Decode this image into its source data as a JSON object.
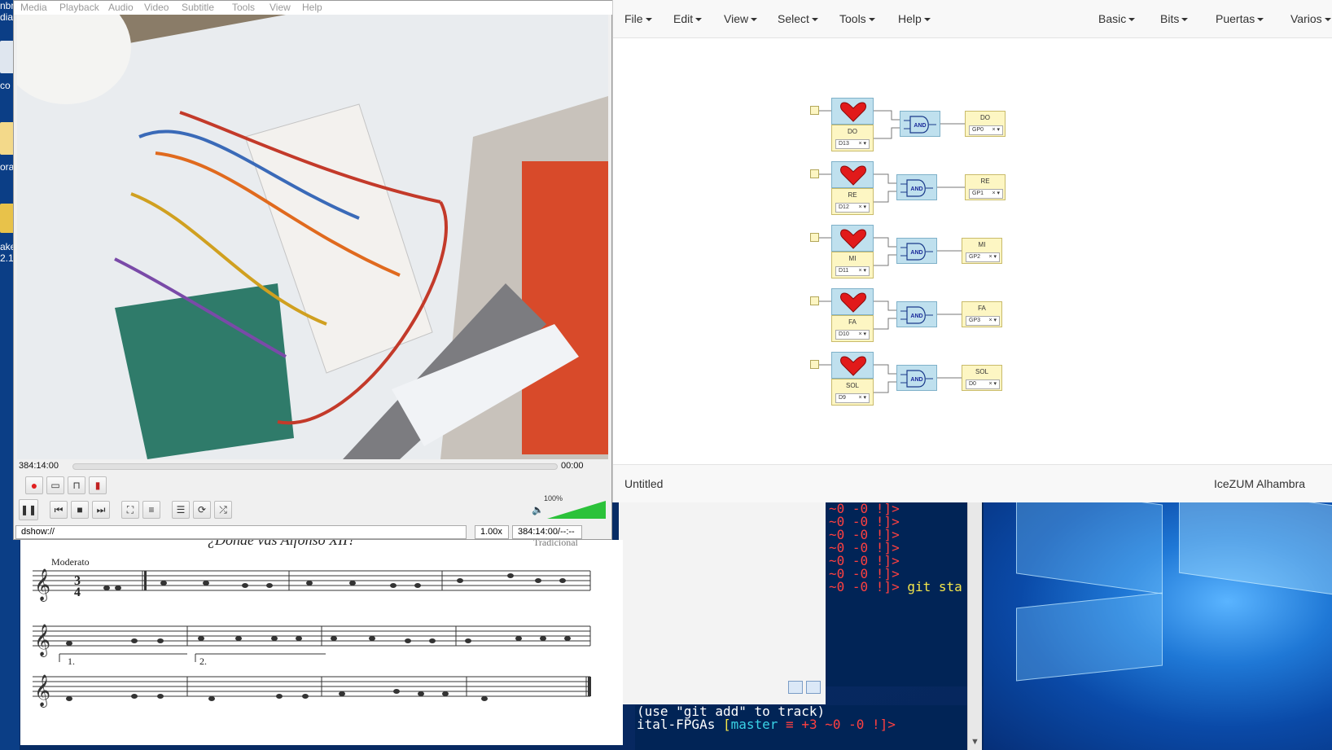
{
  "desktop": {
    "left_icon_texts": [
      "nbr",
      "dia",
      "co",
      "ora",
      "ake",
      "2.1"
    ]
  },
  "vlc": {
    "menu": [
      "Media",
      "Playback",
      "Audio",
      "Video",
      "Subtitle",
      "Tools",
      "View",
      "Help"
    ],
    "elapsed": "384:14:00",
    "remaining": "00:00",
    "volume": "100%",
    "volume_level": 1.0,
    "source": "dshow://",
    "speed": "1.00x",
    "time_status": "384:14:00/--:--"
  },
  "sheet": {
    "title": "¿Donde vas Alfonso XII?",
    "composer": "Tradicional",
    "tempo": "Moderato",
    "time_signature_top": "3",
    "time_signature_bottom": "4",
    "ending1": "1.",
    "ending2": "2."
  },
  "icestudio": {
    "menus": [
      "File",
      "Edit",
      "View",
      "Select",
      "Tools",
      "Help"
    ],
    "right_menus": [
      "Basic",
      "Bits",
      "Puertas",
      "Varios"
    ],
    "footer_left": "Untitled",
    "footer_right": "IceZUM Alhambra",
    "rows": [
      {
        "note": "DO",
        "in_pin": "D13",
        "out_label": "DO",
        "out_pin": "GP0"
      },
      {
        "note": "RE",
        "in_pin": "D12",
        "out_label": "RE",
        "out_pin": "GP1"
      },
      {
        "note": "MI",
        "in_pin": "D11",
        "out_label": "MI",
        "out_pin": "GP2"
      },
      {
        "note": "FA",
        "in_pin": "D10",
        "out_label": "FA",
        "out_pin": "GP3"
      },
      {
        "note": "SOL",
        "in_pin": "D9",
        "out_label": "SOL",
        "out_pin": "D0"
      }
    ],
    "and_label": "AND"
  },
  "terminal": {
    "prompt_fragment": "~0 -0 !]>",
    "last_command": "git sta",
    "hint": "(use \"git add\" to track)",
    "repo_prompt": "ital-FPGAs",
    "branch": "master",
    "branch_status": "≡ +3 ~0 -0 !]>"
  },
  "colors": {
    "icestudio_block_blue": "#bfe0ee",
    "icestudio_block_yellow": "#fdf6c3",
    "terminal_bg": "#012456",
    "vlc_volume_green": "#2bc23a"
  }
}
